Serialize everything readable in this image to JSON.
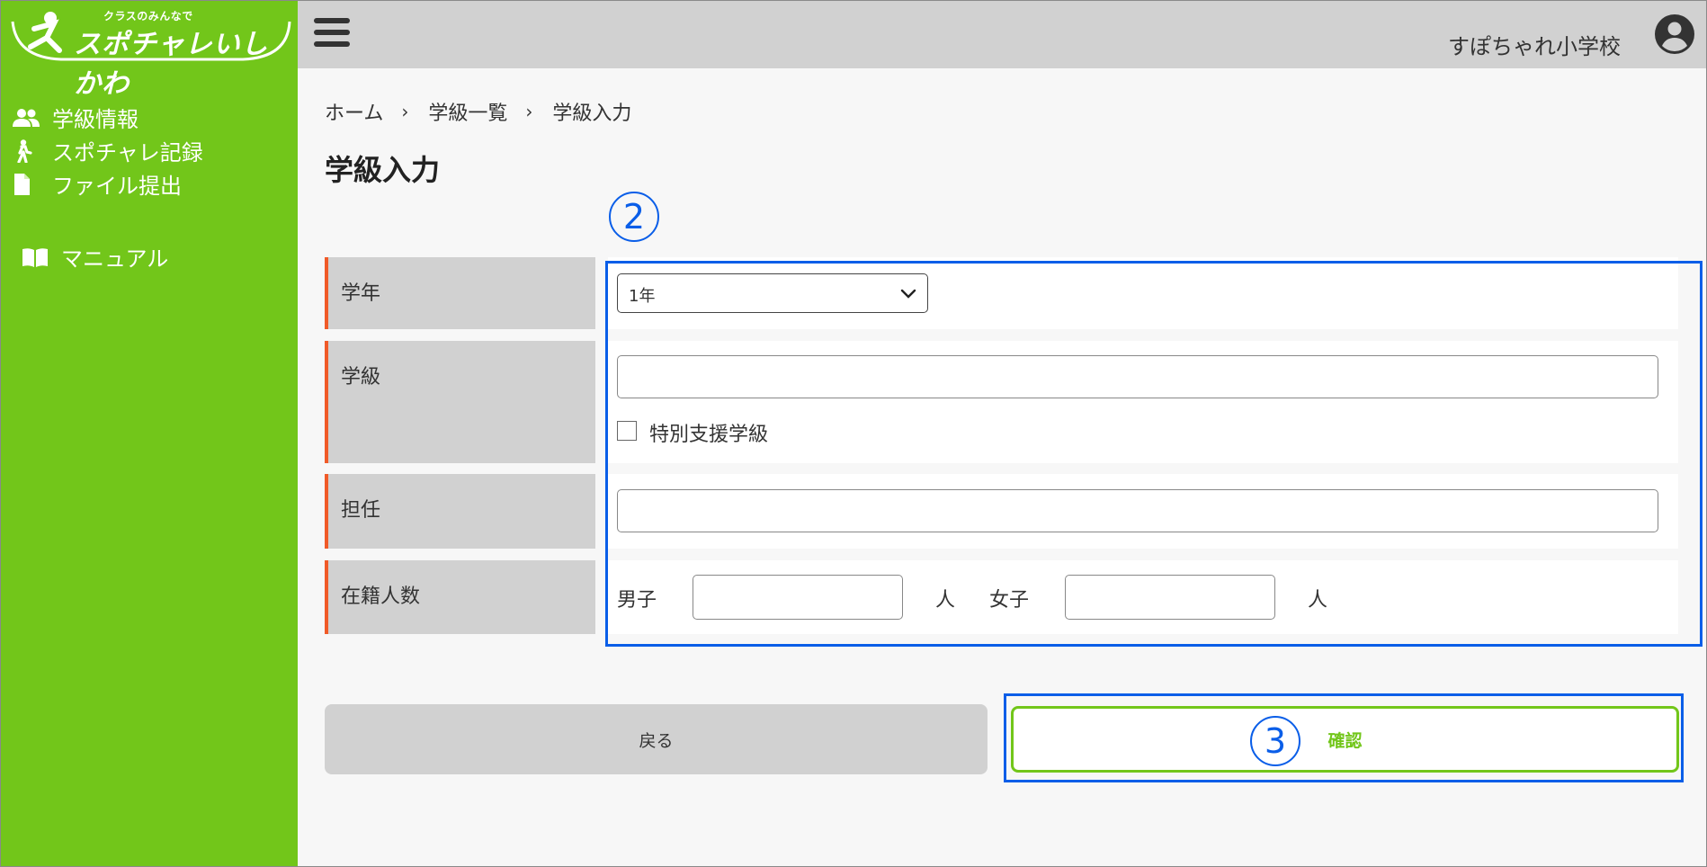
{
  "logo": {
    "tagline": "クラスのみんなで",
    "name": "スポチャレいしかわ"
  },
  "sidebar": {
    "items": [
      {
        "label": "学級情報",
        "icon": "users-icon"
      },
      {
        "label": "スポチャレ記録",
        "icon": "walking-person-icon"
      },
      {
        "label": "ファイル提出",
        "icon": "file-icon"
      }
    ],
    "manual": {
      "label": "マニュアル",
      "icon": "book-icon"
    }
  },
  "header": {
    "school_name": "すぽちゃれ小学校"
  },
  "breadcrumb": {
    "items": [
      "ホーム",
      "学級一覧",
      "学級入力"
    ],
    "separator": "›"
  },
  "page_title": "学級入力",
  "annotations": {
    "form_marker": "2",
    "confirm_marker": "3"
  },
  "form": {
    "grade": {
      "label": "学年",
      "value": "1年"
    },
    "class": {
      "label": "学級",
      "value": "",
      "special_support_label": "特別支援学級",
      "special_support_checked": false
    },
    "teacher": {
      "label": "担任",
      "value": ""
    },
    "enrollment": {
      "label": "在籍人数",
      "male_label": "男子",
      "male_value": "",
      "male_unit": "人",
      "female_label": "女子",
      "female_value": "",
      "female_unit": "人"
    }
  },
  "buttons": {
    "back": "戻る",
    "confirm": "確認"
  },
  "colors": {
    "sidebar": "#72c61a",
    "accent_border": "#f05a28",
    "annotation": "#0a5ee8",
    "header": "#d1d1d1"
  }
}
